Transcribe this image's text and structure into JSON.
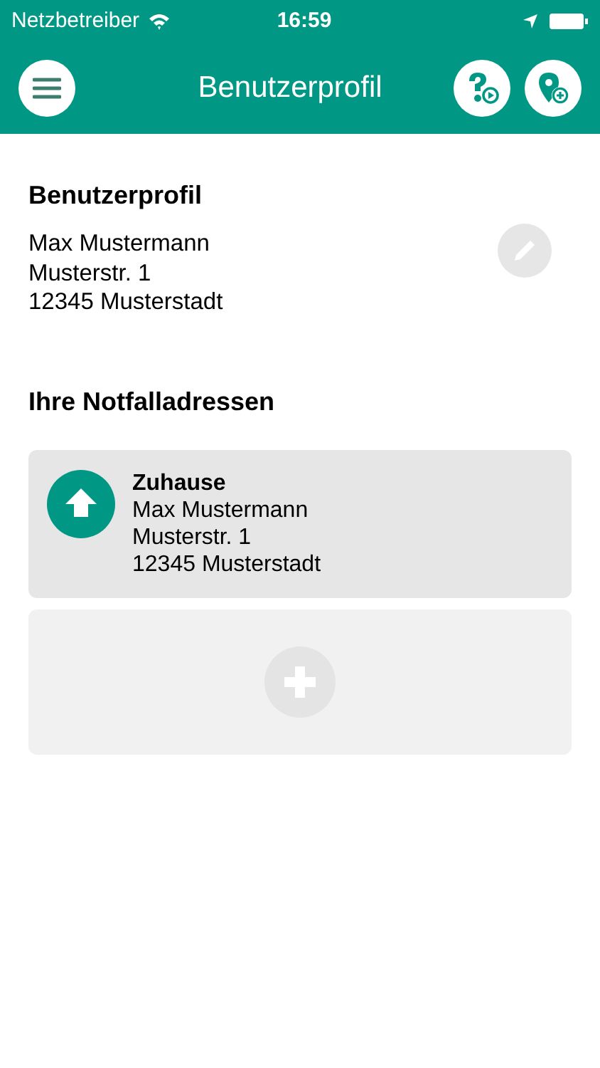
{
  "status_bar": {
    "carrier": "Netzbetreiber",
    "time": "16:59"
  },
  "header": {
    "title": "Benutzerprofil"
  },
  "profile": {
    "heading": "Benutzerprofil",
    "lines": [
      "Max Mustermann",
      "Musterstr. 1",
      "12345 Musterstadt"
    ]
  },
  "emergency": {
    "heading": "Ihre Notfalladressen",
    "addresses": [
      {
        "kind": "home",
        "title": "Zuhause",
        "lines": [
          "Max Mustermann",
          "Musterstr. 1",
          "12345 Musterstadt"
        ]
      }
    ]
  }
}
